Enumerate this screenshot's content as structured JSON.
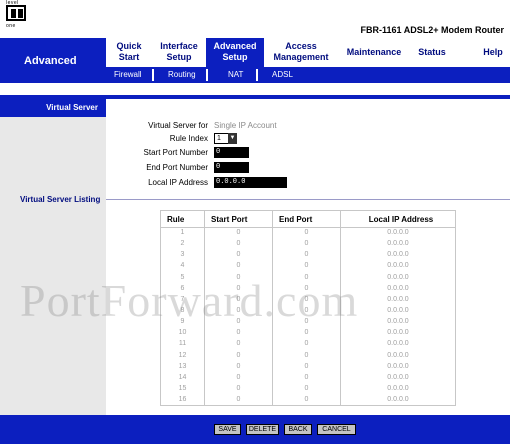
{
  "header": {
    "logo_top": "level",
    "logo_bottom": "one",
    "model": "FBR-1161 ADSL2+ Modem Router"
  },
  "section": "Advanced",
  "nav": [
    {
      "line1": "Quick",
      "line2": "Start"
    },
    {
      "line1": "Interface",
      "line2": "Setup"
    },
    {
      "line1": "Advanced",
      "line2": "Setup"
    },
    {
      "line1": "Access",
      "line2": "Management"
    },
    {
      "line1": "Maintenance",
      "line2": ""
    },
    {
      "line1": "Status",
      "line2": ""
    },
    {
      "line1": "Help",
      "line2": ""
    }
  ],
  "subnav": [
    "Firewall",
    "Routing",
    "NAT",
    "ADSL"
  ],
  "left": {
    "virtual_server": "Virtual Server",
    "listing": "Virtual Server Listing"
  },
  "form": {
    "for_label": "Virtual Server for",
    "for_value": "Single IP Account",
    "rule_index_label": "Rule Index",
    "rule_index_value": "1",
    "start_port_label": "Start Port Number",
    "start_port_value": "0",
    "end_port_label": "End Port Number",
    "end_port_value": "0",
    "local_ip_label": "Local IP Address",
    "local_ip_value": "0.0.0.0"
  },
  "table": {
    "headers": [
      "Rule",
      "Start Port",
      "End Port",
      "Local IP Address"
    ],
    "rows": [
      [
        "1",
        "0",
        "0",
        "0.0.0.0"
      ],
      [
        "2",
        "0",
        "0",
        "0.0.0.0"
      ],
      [
        "3",
        "0",
        "0",
        "0.0.0.0"
      ],
      [
        "4",
        "0",
        "0",
        "0.0.0.0"
      ],
      [
        "5",
        "0",
        "0",
        "0.0.0.0"
      ],
      [
        "6",
        "0",
        "0",
        "0.0.0.0"
      ],
      [
        "7",
        "0",
        "0",
        "0.0.0.0"
      ],
      [
        "8",
        "0",
        "0",
        "0.0.0.0"
      ],
      [
        "9",
        "0",
        "0",
        "0.0.0.0"
      ],
      [
        "10",
        "0",
        "0",
        "0.0.0.0"
      ],
      [
        "11",
        "0",
        "0",
        "0.0.0.0"
      ],
      [
        "12",
        "0",
        "0",
        "0.0.0.0"
      ],
      [
        "13",
        "0",
        "0",
        "0.0.0.0"
      ],
      [
        "14",
        "0",
        "0",
        "0.0.0.0"
      ],
      [
        "15",
        "0",
        "0",
        "0.0.0.0"
      ],
      [
        "16",
        "0",
        "0",
        "0.0.0.0"
      ]
    ]
  },
  "watermark": "PortForward.com",
  "buttons": {
    "save": "SAVE",
    "delete": "DELETE",
    "back": "BACK",
    "cancel": "CANCEL"
  },
  "colors": {
    "brand_blue": "#0c1fbf"
  }
}
